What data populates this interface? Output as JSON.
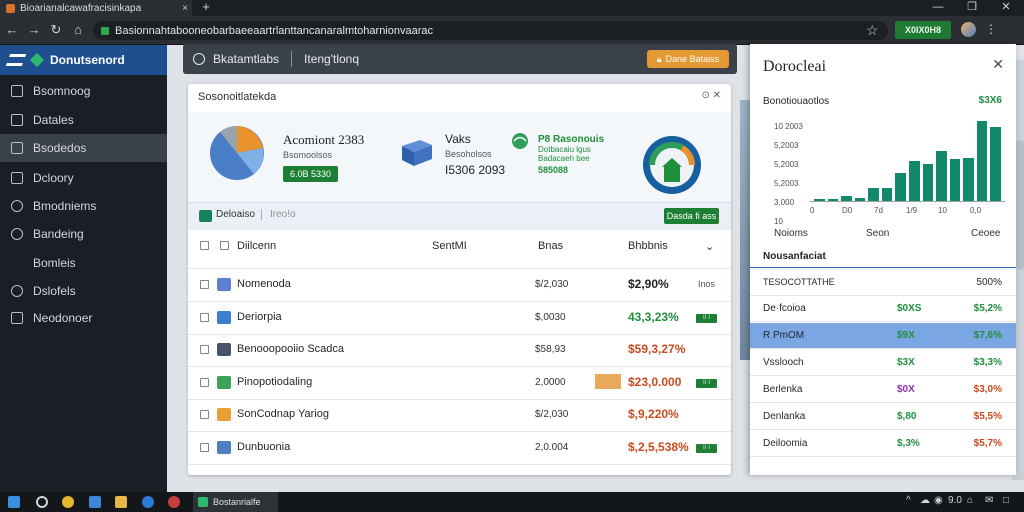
{
  "browser": {
    "tab_title": "Bioarianalcawafracisinkapa",
    "tab_close": "×",
    "new_tab": "+",
    "window_controls": [
      "—",
      "❐",
      "✕"
    ],
    "nav": [
      "←",
      "→",
      "↻",
      "⌂"
    ],
    "url": "Basionnahtabooneobarbaeeaartrlanttancanaralmtoharnionvaarac",
    "star": "☆",
    "extension_label": "X0IX0H8",
    "menu": "⋮"
  },
  "sidebar": {
    "brand": "Donutsenord",
    "items": [
      {
        "label": "Bsomnoog",
        "icon": "grid-icon"
      },
      {
        "label": "Datales",
        "icon": "doc-icon"
      },
      {
        "label": "Bsodedos",
        "icon": "wrench-icon",
        "active": true
      },
      {
        "label": "Dcloory",
        "icon": "folder-icon"
      },
      {
        "label": "Bmodniems",
        "icon": "clock-icon"
      },
      {
        "label": "Bandeing",
        "icon": "search-icon"
      },
      {
        "label": "Bomleis",
        "icon": "none"
      },
      {
        "label": "Dslofels",
        "icon": "people-icon"
      },
      {
        "label": "Neodonoer",
        "icon": "tools-icon"
      }
    ]
  },
  "header": {
    "user_label": "Bkatamtlabs",
    "section_label": "Iteng'tlonq",
    "action_label": "Dane Bataiss"
  },
  "card": {
    "title": "Sosonoitlatekda",
    "controls": "⊙ ✕",
    "kpi1": {
      "title": "Acomiont 2383",
      "sub": "Bsomoolsos",
      "button": "6.0B 5330"
    },
    "kpi2": {
      "label": "Vaks",
      "sub": "Besoholsos",
      "value": "I5306 2093"
    },
    "kpi3": {
      "title": "P8 Rasonouis",
      "sub1": "Dotbacaiu lgus",
      "sub2": "Badacaeh bee",
      "value": "585088"
    },
    "toolbar": {
      "seg1": "Deloaiso",
      "seg2": "Ireo!o",
      "action": "Dasda fi ass"
    },
    "columns": [
      "Diilcenn",
      "SentMI",
      "Bnas",
      "Bhbbnis"
    ],
    "rows": [
      {
        "name": "Nomenoda",
        "amount": "$/2,030",
        "pct": "$2,90%",
        "pct_color": "#1e2226",
        "tag": "Inos",
        "tag_style": "text",
        "icon_color": "#5d7fd0"
      },
      {
        "name": "Deriorpia",
        "amount": "$,0030",
        "pct": "43,3,23%",
        "pct_color": "#1f8f3a",
        "tag": "II·I",
        "tag_style": "green",
        "icon_color": "#3c7fd1"
      },
      {
        "name": "Benooopooiio Scadca",
        "amount": "$58,93",
        "pct": "$59,3,27%",
        "pct_color": "#c74b1e",
        "tag": "",
        "tag_style": "none",
        "icon_color": "#46546a"
      },
      {
        "name": "Pinopotiodaling",
        "amount": "2,0000",
        "pct": "$23,0.000",
        "pct_color": "#c74b1e",
        "tag": "II·I",
        "tag_style": "green",
        "icon_color": "#3aa05a",
        "highlight": "#e8a95a"
      },
      {
        "name": "SonCodnap Yariog",
        "amount": "$/2,030",
        "pct": "$,9,220%",
        "pct_color": "#c74b1e",
        "tag": "",
        "tag_style": "none",
        "icon_color": "#e8a133"
      },
      {
        "name": "Dunbuonia",
        "amount": "2,0.004",
        "pct": "$,2,5,538%",
        "pct_color": "#c74b1e",
        "tag": "II·I",
        "tag_style": "green",
        "icon_color": "#4f7fc2"
      }
    ]
  },
  "panel": {
    "title": "Dorocleai",
    "close": "✕",
    "subtitle": "Bonotiouaotlos",
    "subtitle_value": "$3X6",
    "legend": [
      "Noioms",
      "Seon",
      "Ceoee"
    ],
    "section": "Nousanfaciat",
    "header_row": {
      "label": "TESOCOTTATHE",
      "right": "500%"
    },
    "rows": [
      {
        "label": "De·fcoioa",
        "mid": "$0XS",
        "mid_color": "#1f8f3a",
        "right": "$5,2%",
        "right_color": "#1f8f3a"
      },
      {
        "label": "R PmOM",
        "mid": "$9X",
        "mid_color": "#1f8f3a",
        "right": "$7,6%",
        "right_color": "#1f8f3a",
        "selected": true
      },
      {
        "label": "Vsslooch",
        "mid": "$3X",
        "mid_color": "#1f8f3a",
        "right": "$3,3%",
        "right_color": "#1f8f3a"
      },
      {
        "label": "Berlenka",
        "mid": "$0X",
        "mid_color": "#8b2fb3",
        "right": "$3,0%",
        "right_color": "#c74b1e"
      },
      {
        "label": "Denlanka",
        "mid": "$,80",
        "mid_color": "#1f8f3a",
        "right": "$5,5%",
        "right_color": "#c74b1e"
      },
      {
        "label": "Deiloomia",
        "mid": "$,3%",
        "mid_color": "#1f8f3a",
        "right": "$5,7%",
        "right_color": "#c74b1e"
      }
    ]
  },
  "chart_data": {
    "type": "bar",
    "title": "Bonotiouaotlos",
    "yticks": [
      "10 2003",
      "5,2003",
      "5,2003",
      "5,2003",
      "3,000",
      "10"
    ],
    "xticks": [
      "0",
      "D0",
      "7d",
      "1/9",
      "10",
      "0,0"
    ],
    "values": [
      1,
      1,
      3,
      2,
      8,
      8,
      17,
      24,
      22,
      30,
      25,
      26,
      48,
      44
    ],
    "ylim": [
      0,
      52
    ],
    "color": "#12896a",
    "legend": [
      "Noioms",
      "Seon",
      "Ceoee"
    ]
  },
  "taskbar": {
    "app_label": "Bostanrialfe",
    "tray": [
      "^",
      "☁",
      "◉",
      "9.0",
      "⌂",
      "✉",
      "□"
    ]
  }
}
